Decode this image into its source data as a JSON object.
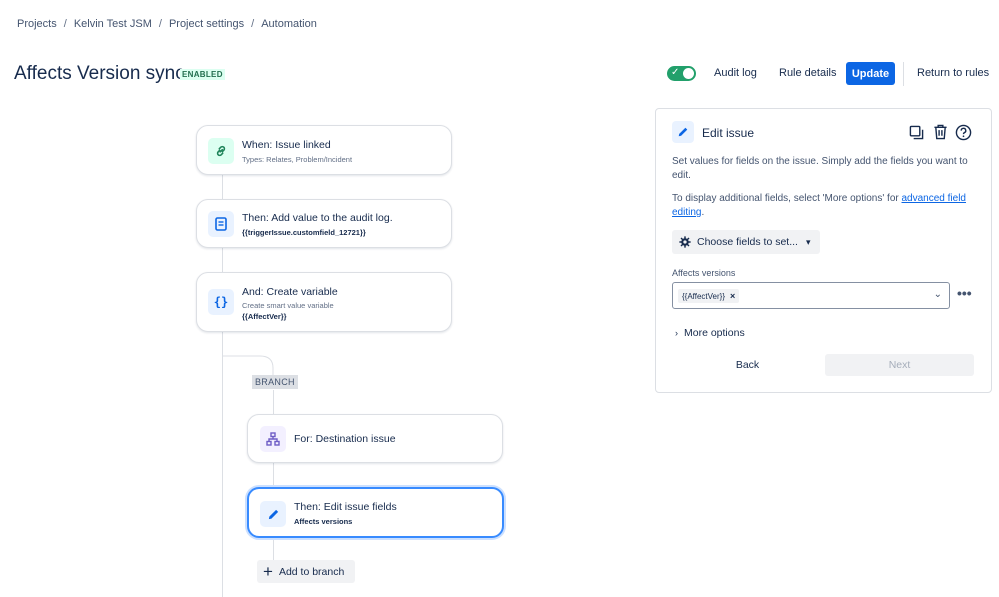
{
  "breadcrumb": [
    "Projects",
    "Kelvin Test JSM",
    "Project settings",
    "Automation"
  ],
  "header": {
    "title": "Affects Version sync",
    "status_badge": "ENABLED",
    "toggle_state": "on",
    "audit_log": "Audit log",
    "rule_details": "Rule details",
    "update": "Update",
    "return": "Return to rules"
  },
  "flow": {
    "trigger": {
      "title": "When: Issue linked",
      "subtitle": "Types: Relates, Problem/Incident",
      "icon": "link-icon"
    },
    "action1": {
      "title": "Then: Add value to the audit log.",
      "detail": "{{triggerIssue.customfield_12721}}",
      "icon": "document-icon"
    },
    "action2": {
      "title": "And: Create variable",
      "subtitle": "Create smart value variable",
      "detail": "{{AffectVer}}",
      "icon": "curly-braces-icon"
    },
    "branch_label": "BRANCH",
    "branch_for": {
      "title": "For: Destination issue",
      "icon": "hierarchy-icon"
    },
    "branch_action": {
      "title": "Then: Edit issue fields",
      "detail": "Affects versions",
      "icon": "pencil-icon"
    },
    "add_to_branch": "Add to branch"
  },
  "panel": {
    "title": "Edit issue",
    "desc1": "Set values for fields on the issue. Simply add the fields you want to edit.",
    "desc2_prefix": "To display additional fields, select 'More options' for ",
    "desc2_link": "advanced field editing",
    "desc2_suffix": ".",
    "choose_fields": "Choose fields to set...",
    "field_label": "Affects versions",
    "field_chip": "{{AffectVer}}",
    "more_options": "More options",
    "back": "Back",
    "next": "Next"
  },
  "colors": {
    "accent": "#0C66E4",
    "toggle_on": "#22A06B",
    "badge_bg": "#DCFFF1",
    "badge_text": "#216E4E",
    "selected_border": "#388BFF"
  }
}
